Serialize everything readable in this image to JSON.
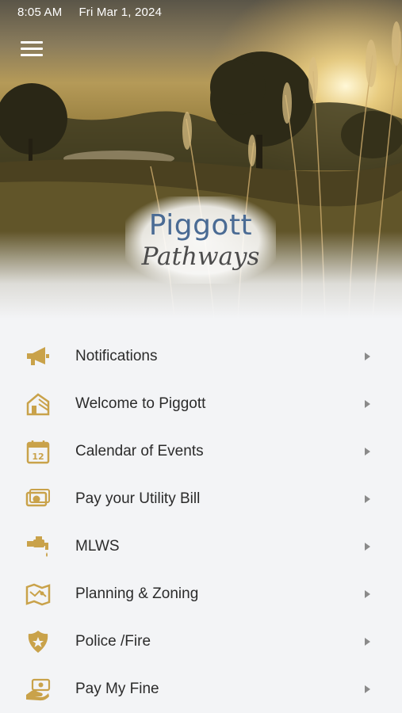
{
  "status_bar": {
    "time": "8:05 AM",
    "date": "Fri Mar 1, 2024"
  },
  "header": {
    "menu_icon": "hamburger-menu-icon"
  },
  "logo": {
    "line1": "Piggott",
    "line2": "Pathways"
  },
  "colors": {
    "icon_gold": "#c9a24a",
    "text": "#2b2b2b",
    "chevron": "#8a8a8a",
    "background": "#f3f4f6"
  },
  "menu": {
    "items": [
      {
        "label": "Notifications",
        "icon": "megaphone-icon"
      },
      {
        "label": "Welcome to Piggott",
        "icon": "house-icon"
      },
      {
        "label": "Calendar of Events",
        "icon": "calendar-icon"
      },
      {
        "label": "Pay your Utility Bill",
        "icon": "money-icon"
      },
      {
        "label": "MLWS",
        "icon": "water-faucet-icon"
      },
      {
        "label": "Planning & Zoning",
        "icon": "map-icon"
      },
      {
        "label": "Police /Fire",
        "icon": "badge-icon"
      },
      {
        "label": "Pay My Fine",
        "icon": "payment-hand-icon"
      }
    ]
  }
}
